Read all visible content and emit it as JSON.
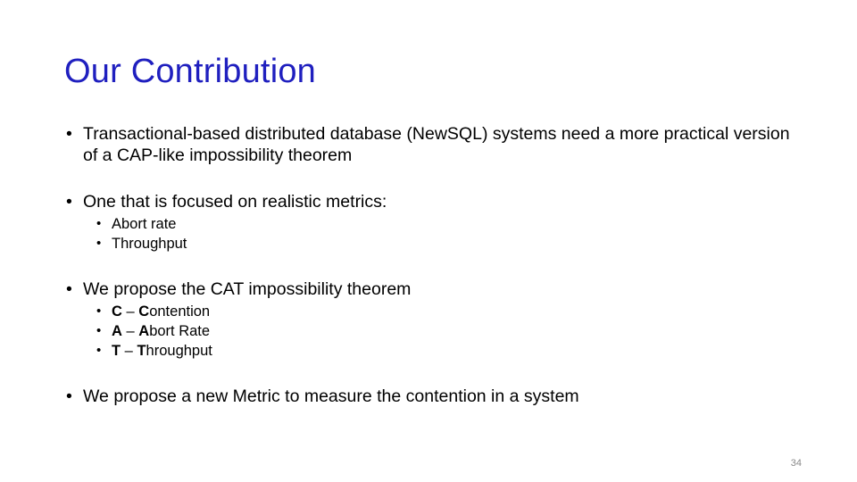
{
  "slide": {
    "title": "Our Contribution",
    "title_color": "#1f1fbf",
    "background_color": "#ffffff",
    "page_number": "34",
    "page_number_color": "#8a8a8a",
    "bullet_marker": "•",
    "groups": [
      {
        "text": "Transactional-based distributed database (NewSQL) systems need a more practical version of a CAP-like impossibility theorem",
        "sub_items": []
      },
      {
        "text": "One that is focused on realistic metrics:",
        "sub_items": [
          {
            "lead": "",
            "rest": "Abort rate"
          },
          {
            "lead": "",
            "rest": "Throughput"
          }
        ]
      },
      {
        "text": "We propose the CAT impossibility theorem",
        "sub_items": [
          {
            "lead": "C",
            "sep": " – ",
            "lead2": "C",
            "rest": "ontention"
          },
          {
            "lead": "A",
            "sep": " – ",
            "lead2": "A",
            "rest": "bort Rate"
          },
          {
            "lead": "T",
            "sep": " – ",
            "lead2": "T",
            "rest": "hroughput"
          }
        ]
      },
      {
        "text": "We propose a new Metric to measure the contention in a system",
        "sub_items": []
      }
    ]
  }
}
